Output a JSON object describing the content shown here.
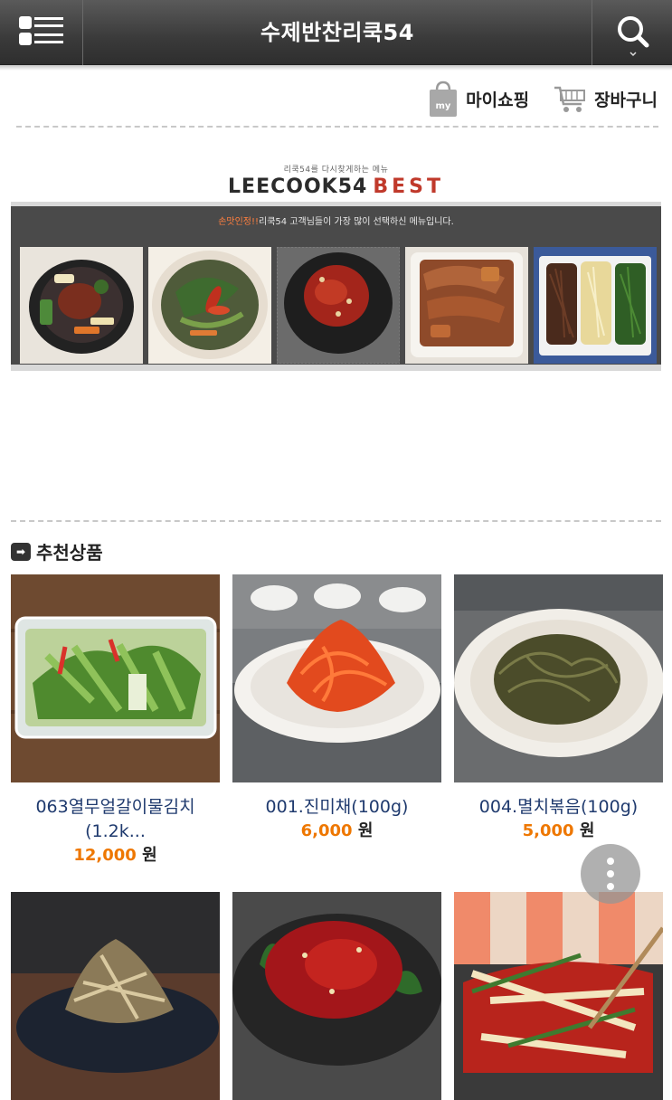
{
  "header": {
    "title": "수제반찬리쿡54",
    "menu_icon": "list-menu-icon",
    "search_icon": "search-icon"
  },
  "quick_links": [
    {
      "label": "마이쇼핑",
      "icon": "shopping-bag-icon",
      "icon_text": "my"
    },
    {
      "label": "장바구니",
      "icon": "cart-icon"
    }
  ],
  "banner": {
    "subtitle": "리쿡54를 다시찾게하는 메뉴",
    "brand": "LEECOOK54",
    "best": "BEST",
    "caption_highlight": "손맛인정!!",
    "caption_rest": "리쿡54 고객님들이 가장 많이 선택하신 메뉴입니다."
  },
  "recommend": {
    "title": "추천상품",
    "products": [
      {
        "name": "063열무얼갈이물김치",
        "name2": "(1.2k...",
        "price": "12,000",
        "unit": "원"
      },
      {
        "name": "001.진미채(100g)",
        "price": "6,000",
        "unit": "원"
      },
      {
        "name": "004.멸치볶음(100g)",
        "price": "5,000",
        "unit": "원"
      },
      {
        "name": "",
        "price": "",
        "unit": ""
      },
      {
        "name": "",
        "price": "",
        "unit": ""
      },
      {
        "name": "",
        "price": "",
        "unit": ""
      }
    ]
  },
  "colors": {
    "header": "#3a3a3a",
    "price_accent": "#ee7700",
    "product_name": "#1f3a6e",
    "best_accent": "#c0392b"
  }
}
